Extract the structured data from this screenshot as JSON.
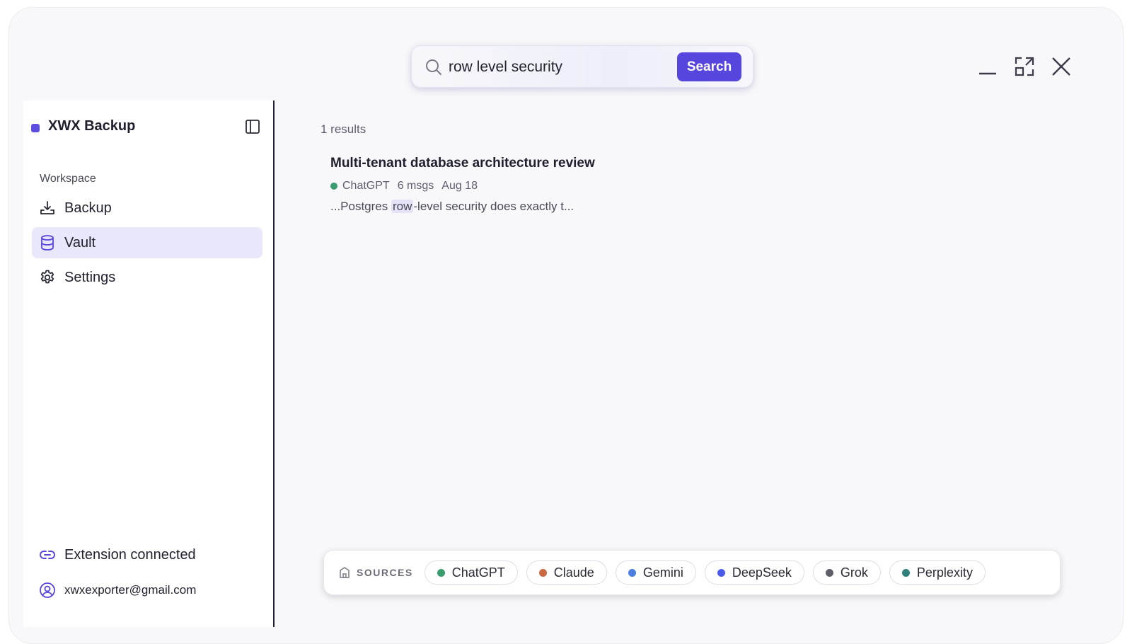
{
  "search": {
    "value": "row level security",
    "button_label": "Search"
  },
  "sidebar": {
    "brand": "XWX Backup",
    "section_label": "Workspace",
    "items": [
      {
        "label": "Backup",
        "icon": "download-tray-icon"
      },
      {
        "label": "Vault",
        "icon": "database-icon",
        "active": true
      },
      {
        "label": "Settings",
        "icon": "gear-icon"
      }
    ],
    "footer": {
      "extension_status": "Extension connected",
      "email": "xwxexporter@gmail.com"
    }
  },
  "main": {
    "results_count": "1 results",
    "results": [
      {
        "title": "Multi-tenant database architecture review",
        "source": "ChatGPT",
        "source_color": "#3a9b6e",
        "messages": "6 msgs",
        "date": "Aug 18",
        "snippet_before": "...Postgres ",
        "snippet_highlight": "row",
        "snippet_after": "-level security does exactly t..."
      }
    ]
  },
  "sources": {
    "label": "SOURCES",
    "chips": [
      {
        "label": "ChatGPT",
        "color": "#3a9b6e"
      },
      {
        "label": "Claude",
        "color": "#c96a45"
      },
      {
        "label": "Gemini",
        "color": "#4a7fe0"
      },
      {
        "label": "DeepSeek",
        "color": "#4a5bea"
      },
      {
        "label": "Grok",
        "color": "#5e5e68"
      },
      {
        "label": "Perplexity",
        "color": "#2f7f7a"
      }
    ]
  },
  "colors": {
    "accent": "#5746dd",
    "active_nav_bg": "#e9e7fa"
  }
}
